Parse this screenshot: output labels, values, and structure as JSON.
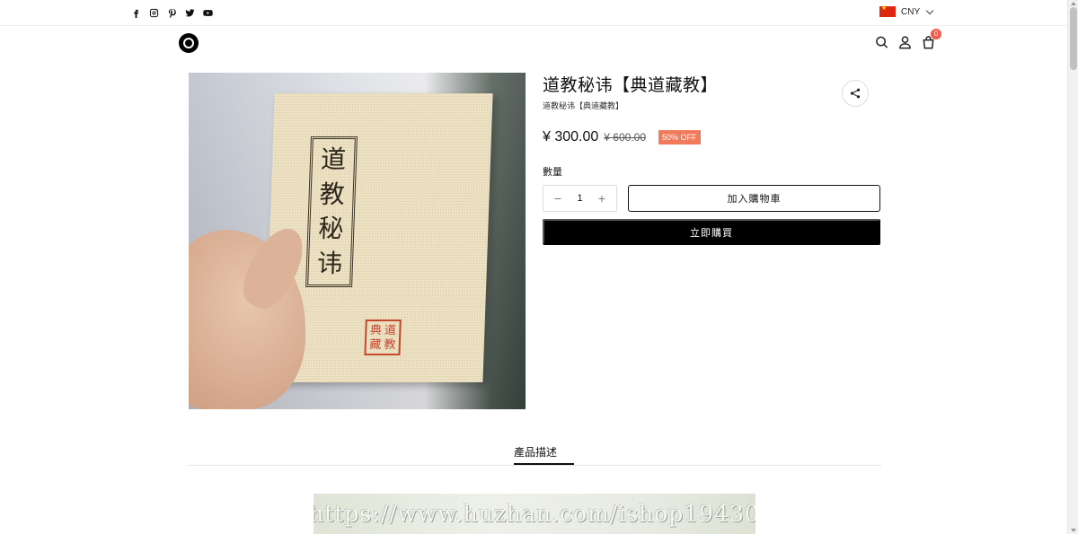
{
  "topbar": {
    "social_icons": [
      "facebook-icon",
      "instagram-icon",
      "pinterest-icon",
      "twitter-icon",
      "youtube-icon"
    ],
    "currency": "CNY"
  },
  "header": {
    "cart_count": "0"
  },
  "product": {
    "title": "道教秘讳【典道藏教】",
    "subtitle": "道教秘讳【典道藏教】",
    "price": "¥ 300.00",
    "compare_price": "¥ 600.00",
    "discount_badge": "50% OFF",
    "quantity_label": "數量",
    "quantity": "1",
    "decrement": "−",
    "increment": "+",
    "add_to_cart": "加入購物車",
    "buy_now": "立即購買",
    "image": {
      "cover_chars": [
        "道",
        "教",
        "秘",
        "讳"
      ],
      "seal_chars": [
        "典",
        "道",
        "藏",
        "教"
      ]
    }
  },
  "tabs": [
    {
      "label": "產品描述",
      "active": true
    }
  ],
  "description": {
    "watermark_url": "https://www.huzhan.com/ishop19430"
  },
  "colors": {
    "accent_badge": "#f07a5a",
    "buy_button": "#000000",
    "cart_badge": "#f05a4a"
  }
}
